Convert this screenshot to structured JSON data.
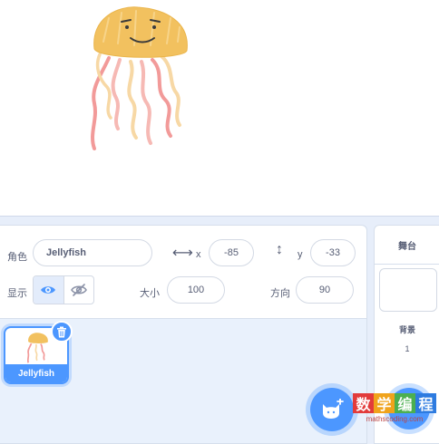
{
  "sprite_info": {
    "sprite_label": "角色",
    "name_value": "Jellyfish",
    "x_label": "x",
    "x_value": "-85",
    "y_label": "y",
    "y_value": "-33",
    "show_label": "显示",
    "size_label": "大小",
    "size_value": "100",
    "direction_label": "方向",
    "direction_value": "90"
  },
  "sprites": [
    {
      "name": "Jellyfish",
      "selected": true
    }
  ],
  "stage_panel": {
    "title": "舞台",
    "backdrops_label": "背景",
    "backdrops_count": "1"
  },
  "watermark": {
    "chars": [
      "数",
      "学",
      "编",
      "程"
    ],
    "url": "mathscoding.com"
  },
  "colors": {
    "accent": "#4c97ff",
    "panel_bg": "#e9f1fc",
    "text": "#575e75"
  },
  "icons": {
    "show": "eye-icon",
    "hide": "eye-slash-icon",
    "delete": "trash-icon",
    "choose_sprite": "cat-plus-icon",
    "x_axis": "horizontal-arrows-icon",
    "y_axis": "vertical-arrows-icon"
  }
}
